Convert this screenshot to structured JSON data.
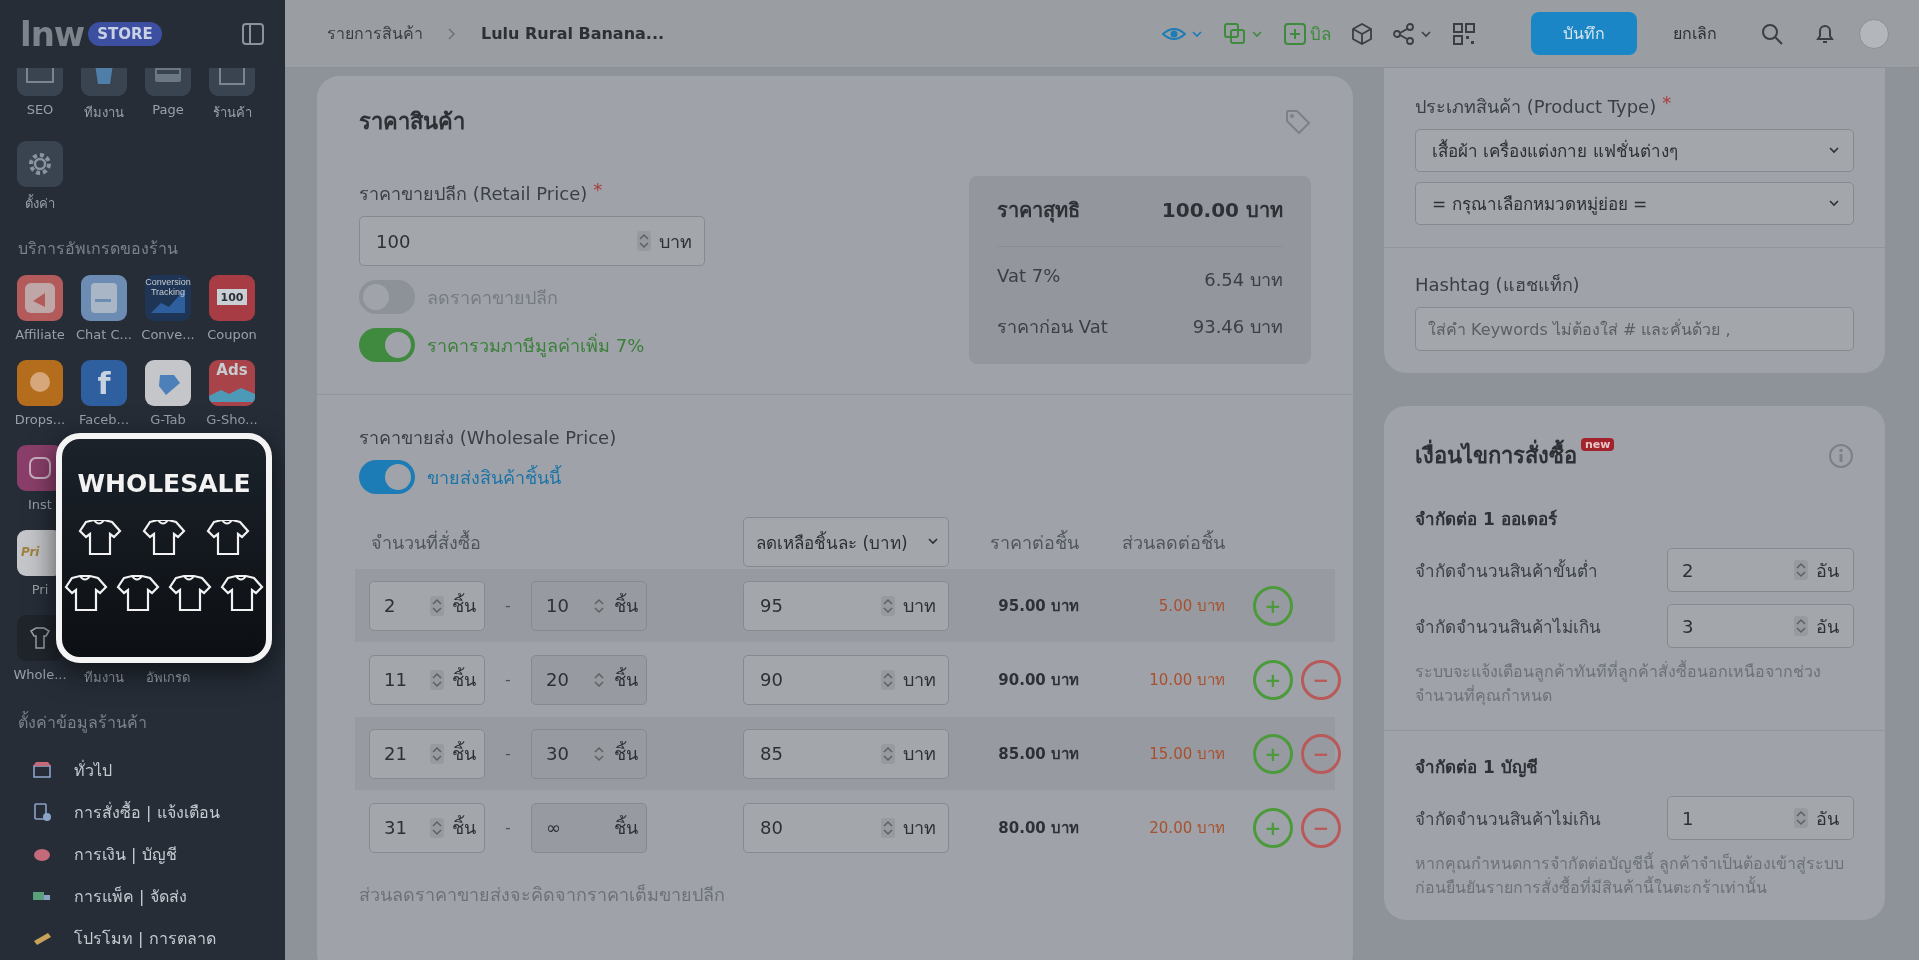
{
  "sidebar": {
    "logo": {
      "text": "lnw",
      "badge": "STORE"
    },
    "top_apps": [
      {
        "label": "SEO",
        "kind": "seo"
      },
      {
        "label": "ทีมงาน",
        "kind": "team"
      },
      {
        "label": "Page",
        "kind": "page"
      },
      {
        "label": "ร้านค้า",
        "kind": "shop"
      }
    ],
    "settings_app": {
      "label": "ตั้งค่า",
      "kind": "settings"
    },
    "upgrade_section": {
      "title": "บริการอัพเกรดของร้าน",
      "rows": [
        [
          {
            "label": "Affiliate",
            "kind": "affiliate"
          },
          {
            "label": "Chat C...",
            "kind": "chat"
          },
          {
            "label": "Conve...",
            "kind": "conversion",
            "icon_text": "Conversion Tracking"
          },
          {
            "label": "Coupon",
            "kind": "coupon",
            "icon_text": "100"
          }
        ],
        [
          {
            "label": "Drops...",
            "kind": "dropship"
          },
          {
            "label": "Faceb...",
            "kind": "facebook",
            "icon_text": "f"
          },
          {
            "label": "G-Tab",
            "kind": "gtab"
          },
          {
            "label": "G-Sho...",
            "kind": "gshop",
            "icon_text": "Ads"
          }
        ],
        [
          {
            "label": "Inst",
            "kind": "instagram"
          }
        ],
        [
          {
            "label": "Pri",
            "kind": "price",
            "icon_text": "Pri"
          }
        ],
        [
          {
            "label": "Whole...",
            "kind": "wholesale"
          },
          {
            "label": "ทีมงาน",
            "kind": "none"
          },
          {
            "label": "อัพเกรด",
            "kind": "none"
          }
        ]
      ]
    },
    "popup": {
      "title": "WHOLESALE"
    },
    "store_settings": {
      "title": "ตั้งค่าข้อมูลร้านค้า",
      "items": [
        {
          "label": "ทั่วไป",
          "kind": "general"
        },
        {
          "label": "การสั่งซื้อ | แจ้งเตือน",
          "kind": "order"
        },
        {
          "label": "การเงิน | บัญชี",
          "kind": "finance"
        },
        {
          "label": "การแพ็ค | จัดส่ง",
          "kind": "shipping"
        },
        {
          "label": "โปรโมท | การตลาด",
          "kind": "promo"
        }
      ]
    }
  },
  "topbar": {
    "breadcrumb": [
      "รายการสินค้า",
      "Lulu Rural Banana..."
    ],
    "bill_label": "บิล",
    "save_label": "บันทึก",
    "cancel_label": "ยกเลิก"
  },
  "price_card": {
    "title": "ราคาสินค้า",
    "retail": {
      "label": "ราคาขายปลีก (Retail Price)",
      "required_mark": "*",
      "value": "100",
      "unit": "บาท"
    },
    "toggles": [
      {
        "label": "ลดราคาขายปลีก",
        "on": false
      },
      {
        "label": "ราคารวมภาษีมูลค่าเพิ่ม 7%",
        "on": true
      }
    ],
    "summary": {
      "net_label": "ราคาสุทธิ",
      "net_value": "100.00 บาท",
      "rows": [
        {
          "label": "Vat 7%",
          "value": "6.54 บาท"
        },
        {
          "label": "ราคาก่อน Vat",
          "value": "93.46 บาท"
        }
      ]
    },
    "wholesale": {
      "label": "ราคาขายส่ง (Wholesale Price)",
      "toggle": {
        "label": "ขายส่งสินค้าชิ้นนี้",
        "on": true
      },
      "qty_header": "จำนวนที่สั่งซื้อ",
      "mode_select": "ลดเหลือชิ้นละ (บาท)",
      "price_header": "ราคาต่อชิ้น",
      "discount_header": "ส่วนลดต่อชิ้น",
      "add_button": "+",
      "remove_button": "−",
      "range_separator": "-",
      "rows": [
        {
          "from": "2",
          "to": "10",
          "qty_unit": "ชิ้น",
          "to_unit": "ชิ้น",
          "price": "95",
          "price_unit": "บาท",
          "per_piece": "95.00 บาท",
          "discount": "5.00 บาท",
          "removable": false
        },
        {
          "from": "11",
          "to": "20",
          "qty_unit": "ชิ้น",
          "to_unit": "ชิ้น",
          "price": "90",
          "price_unit": "บาท",
          "per_piece": "90.00 บาท",
          "discount": "10.00 บาท",
          "removable": true
        },
        {
          "from": "21",
          "to": "30",
          "qty_unit": "ชิ้น",
          "to_unit": "ชิ้น",
          "price": "85",
          "price_unit": "บาท",
          "per_piece": "85.00 บาท",
          "discount": "15.00 บาท",
          "removable": true
        },
        {
          "from": "31",
          "to": "∞",
          "qty_unit": "ชิ้น",
          "to_unit": "ชิ้น",
          "price": "80",
          "price_unit": "บาท",
          "per_piece": "80.00 บาท",
          "discount": "20.00 บาท",
          "removable": true
        }
      ],
      "note": "ส่วนลดราคาขายส่งจะคิดจากราคาเต็มขายปลีก"
    }
  },
  "product_card": {
    "type_label": "ประเภทสินค้า (Product Type)",
    "required_mark": "*",
    "type_value": "เสื้อผ้า เครื่องแต่งกาย แฟชั่นต่างๆ",
    "subtype_value": "= กรุณาเลือกหมวดหมู่ย่อย =",
    "hashtag_label": "Hashtag (แฮชแท็ก)",
    "hashtag_placeholder": "ใส่คำ Keywords ไม่ต้องใส่ # และคั่นด้วย ,"
  },
  "conditions_card": {
    "title": "เงื่อนไขการสั่งซื้อ",
    "badge": "new",
    "sections": [
      {
        "title": "จำกัดต่อ 1 ออเดอร์",
        "rows": [
          {
            "label": "จำกัดจำนวนสินค้าขั้นต่ำ",
            "value": "2",
            "unit": "อัน"
          },
          {
            "label": "จำกัดจำนวนสินค้าไม่เกิน",
            "value": "3",
            "unit": "อัน"
          }
        ],
        "note": "ระบบจะแจ้งเตือนลูกค้าทันทีที่ลูกค้าสั่งซื้อนอกเหนือจากช่วงจำนวนที่คุณกำหนด"
      },
      {
        "title": "จำกัดต่อ 1 บัญชี",
        "rows": [
          {
            "label": "จำกัดจำนวนสินค้าไม่เกิน",
            "value": "1",
            "unit": "อัน"
          }
        ],
        "note": "หากคุณกำหนดการจำกัดต่อบัญชีนี้ ลูกค้าจำเป็นต้องเข้าสู่ระบบก่อนยืนยันรายการสั่งซื้อที่มีสินค้านี้ในตะกร้าเท่านั้น"
      }
    ]
  }
}
